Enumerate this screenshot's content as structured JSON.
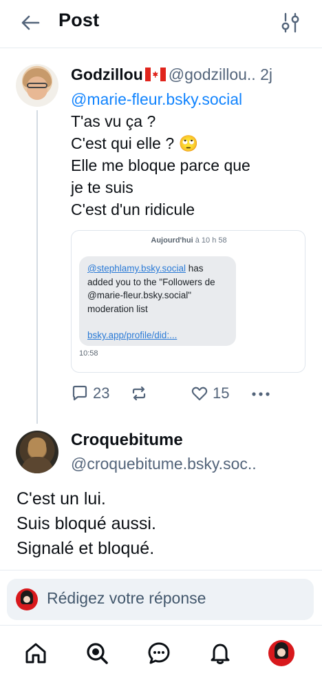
{
  "header": {
    "title": "Post",
    "back_icon": "arrow-left-icon",
    "filter_icon": "sliders-icon"
  },
  "post1": {
    "author_name": "Godzillou",
    "flag": "🇨🇦",
    "handle": "@godzillou..",
    "time": "2j",
    "mention": "@marie-fleur.bsky.social",
    "lines": [
      "T'as vu ça ?",
      "C'est qui elle ? 🙄",
      "Elle me bloque parce que",
      "je te suis",
      "C'est d'un ridicule"
    ],
    "embed": {
      "date_bold": "Aujourd'hui",
      "date_rest": " à 10 h 58",
      "bubble_link": "@stephlamy.bsky.social",
      "bubble_text": " has added you to the \"Followers de @marie-fleur.bsky.social\" moderation list",
      "bubble_url": "bsky.app/profile/did:...",
      "time": "10:58"
    },
    "actions": {
      "replies": "23",
      "likes": "15"
    }
  },
  "post2": {
    "author_name": "Croquebitume",
    "handle": "@croquebitume.bsky.soc..",
    "lines": [
      "C'est un lui.",
      "Suis bloqué aussi.",
      "Signalé et bloqué."
    ]
  },
  "reply": {
    "placeholder": "Rédigez votre réponse"
  },
  "nav": {
    "items": [
      "home-icon",
      "search-icon",
      "chat-icon",
      "bell-icon",
      "profile-avatar"
    ]
  },
  "colors": {
    "accent": "#1083fe",
    "muted": "#53647a",
    "text": "#0b0f14"
  }
}
